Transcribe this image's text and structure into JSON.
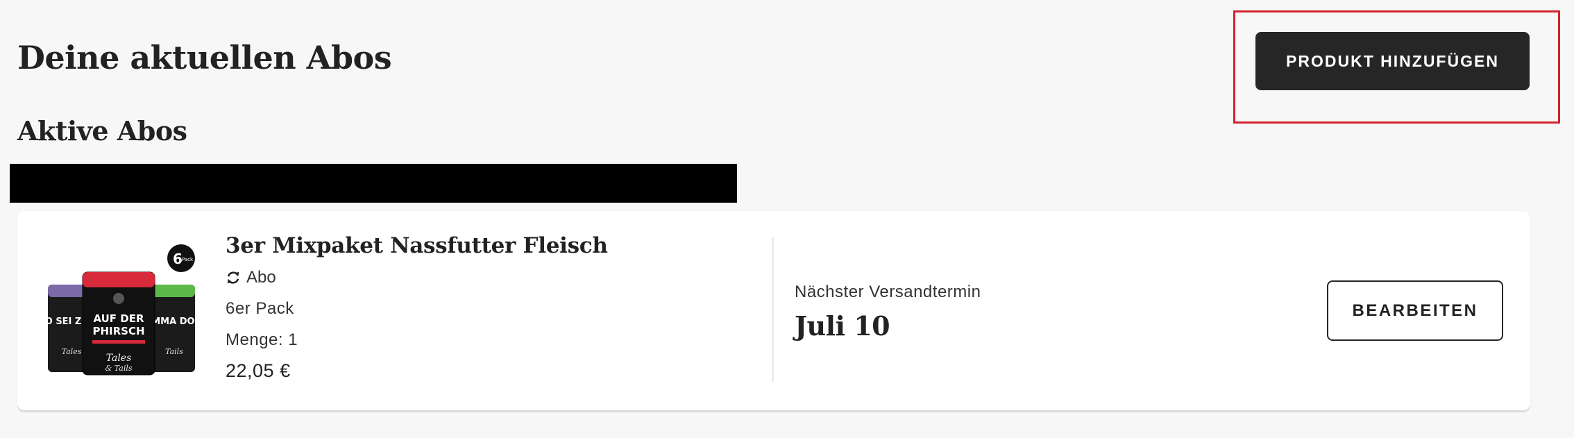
{
  "header": {
    "title": "Deine aktuellen Abos",
    "add_button_label": "PRODUKT HINZUFÜGEN"
  },
  "section": {
    "title": "Aktive Abos"
  },
  "subscription": {
    "product_name": "3er Mixpaket Nassfutter Fleisch",
    "type_label": "Abo",
    "pack_label": "6er Pack",
    "quantity_label": "Menge: 1",
    "price": "22,05 €",
    "shipping_label": "Nächster Versandtermin",
    "shipping_date": "Juli 10",
    "edit_button_label": "BEARBEITEN",
    "image": {
      "cans": [
        "SO SEI ZIEGE",
        "AUF DER PHIRSCH",
        "LAMMA DONG"
      ],
      "badge": "6er Pack",
      "brand": "Tales & Tails"
    }
  },
  "colors": {
    "page_background": "#f7f7f7",
    "primary_button": "#262626",
    "highlight": "#d3222f",
    "can_purple": "#7b6aa8",
    "can_red": "#d82a3c",
    "can_green": "#5cb848"
  }
}
